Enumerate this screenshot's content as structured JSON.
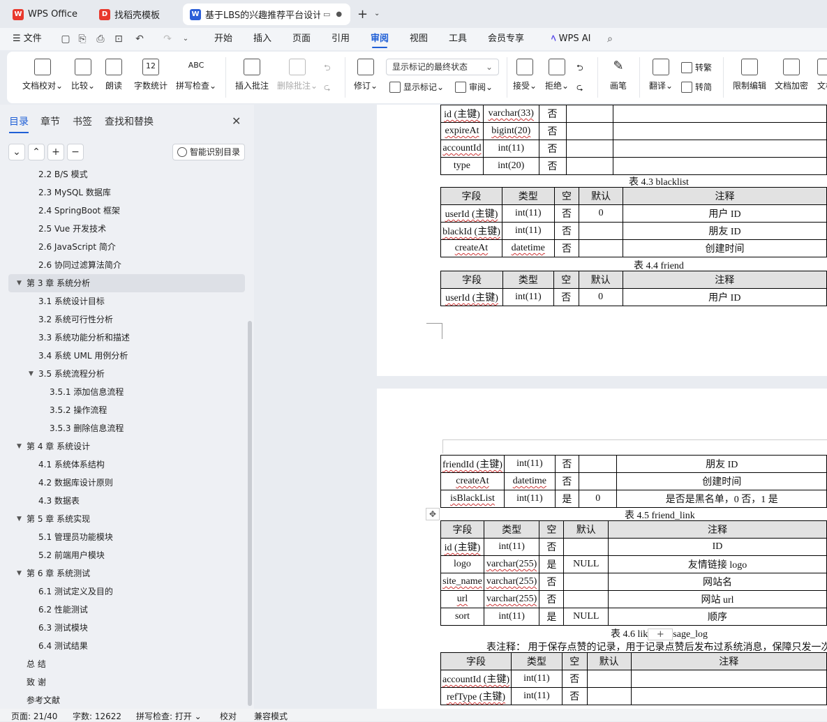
{
  "tabs": [
    {
      "label": "WPS Office",
      "icon": "wps-logo-icon"
    },
    {
      "label": "找稻壳模板",
      "icon": "docer-logo-icon"
    },
    {
      "label": "基于LBS的兴趣推荐平台设计与",
      "icon": "wps-writer-icon"
    }
  ],
  "menu": {
    "file": "文件",
    "items": [
      "开始",
      "插入",
      "页面",
      "引用",
      "审阅",
      "视图",
      "工具",
      "会员专享"
    ],
    "active": "审阅",
    "ai": "WPS AI"
  },
  "ribbon": {
    "doc_check": "文档校对",
    "compare": "比较",
    "read_aloud": "朗读",
    "word_count": "字数统计",
    "spell_check": "拼写检查",
    "spell_icon_text": "ABC",
    "count_icon_text": "12",
    "insert_comment": "插入批注",
    "delete_comment": "删除批注",
    "revise": "修订",
    "markup_state": "显示标记的最终状态",
    "show_markup": "显示标记",
    "review": "审阅",
    "accept": "接受",
    "reject": "拒绝",
    "pen": "画笔",
    "translate": "翻译",
    "to_traditional": "转繁",
    "to_simplified": "转简",
    "restrict_edit": "限制编辑",
    "doc_encrypt": "文档加密",
    "doc_more": "文档"
  },
  "panel": {
    "tabs": [
      "目录",
      "章节",
      "书签",
      "查找和替换"
    ],
    "smart_toc": "智能识别目录",
    "toc": [
      {
        "text": "2.2 B/S 模式",
        "level": 2
      },
      {
        "text": "2.3 MySQL 数据库",
        "level": 2
      },
      {
        "text": "2.4 SpringBoot 框架",
        "level": 2
      },
      {
        "text": "2.5 Vue 开发技术",
        "level": 2
      },
      {
        "text": "2.6 JavaScript 简介",
        "level": 2
      },
      {
        "text": "2.6  协同过滤算法简介",
        "level": 2
      },
      {
        "text": "第 3 章  系统分析",
        "level": 1,
        "expanded": true,
        "selected": true
      },
      {
        "text": "3.1  系统设计目标",
        "level": 2
      },
      {
        "text": "3.2  系统可行性分析",
        "level": 2
      },
      {
        "text": "3.3  系统功能分析和描述",
        "level": 2
      },
      {
        "text": "3.4  系统 UML 用例分析",
        "level": 2
      },
      {
        "text": "3.5 系统流程分析",
        "level": 2,
        "expanded": true
      },
      {
        "text": "3.5.1 添加信息流程",
        "level": 3
      },
      {
        "text": "3.5.2 操作流程",
        "level": 3
      },
      {
        "text": "3.5.3 删除信息流程",
        "level": 3
      },
      {
        "text": "第 4 章  系统设计",
        "level": 1,
        "expanded": true
      },
      {
        "text": "4.1  系统体系结构",
        "level": 2
      },
      {
        "text": "4.2  数据库设计原则",
        "level": 2
      },
      {
        "text": "4.3  数据表",
        "level": 2
      },
      {
        "text": "第 5 章  系统实现",
        "level": 1,
        "expanded": true
      },
      {
        "text": "5.1  管理员功能模块",
        "level": 2
      },
      {
        "text": "5.2  前端用户模块",
        "level": 2
      },
      {
        "text": "第 6 章  系统测试",
        "level": 1,
        "expanded": true
      },
      {
        "text": "6.1 测试定义及目的",
        "level": 2
      },
      {
        "text": "6.2 性能测试",
        "level": 2
      },
      {
        "text": "6.3 测试模块",
        "level": 2
      },
      {
        "text": "6.4 测试结果",
        "level": 2
      },
      {
        "text": "总    结",
        "level": 1
      },
      {
        "text": "致    谢",
        "level": 1
      },
      {
        "text": "参考文献",
        "level": 1
      }
    ]
  },
  "doc": {
    "t42_rows": [
      [
        "id (主键)",
        "varchar(33)",
        "否",
        "",
        ""
      ],
      [
        "expireAt",
        "bigint(20)",
        "否",
        "",
        ""
      ],
      [
        "accountId",
        "int(11)",
        "否",
        "",
        ""
      ],
      [
        "type",
        "int(20)",
        "否",
        "",
        ""
      ]
    ],
    "t43_caption": "表 4.3 blacklist",
    "headers": [
      "字段",
      "类型",
      "空",
      "默认",
      "注释"
    ],
    "t43_rows": [
      [
        "userId (主键)",
        "int(11)",
        "否",
        "0",
        "用户 ID"
      ],
      [
        "blackId (主键)",
        "int(11)",
        "否",
        "",
        "朋友 ID"
      ],
      [
        "createAt",
        "datetime",
        "否",
        "",
        "创建时间"
      ]
    ],
    "t44_caption": "表 4.4 friend",
    "t44_rows": [
      [
        "userId (主键)",
        "int(11)",
        "否",
        "0",
        "用户 ID"
      ]
    ],
    "t44b_rows": [
      [
        "friendId (主键)",
        "int(11)",
        "否",
        "",
        "朋友 ID"
      ],
      [
        "createAt",
        "datetime",
        "否",
        "",
        "创建时间"
      ],
      [
        "isBlackList",
        "int(11)",
        "是",
        "0",
        "是否是黑名单，0 否，1 是"
      ]
    ],
    "t45_caption": "表 4.5 friend_link",
    "t45_rows": [
      [
        "id (主键)",
        "int(11)",
        "否",
        "",
        "ID"
      ],
      [
        "logo",
        "varchar(255)",
        "是",
        "NULL",
        "友情链接 logo"
      ],
      [
        "site_name",
        "varchar(255)",
        "否",
        "",
        "网站名"
      ],
      [
        "url",
        "varchar(255)",
        "否",
        "",
        "网站 url"
      ],
      [
        "sort",
        "int(11)",
        "是",
        "NULL",
        "顺序"
      ]
    ],
    "t46_caption_a": "表 4.6 lik",
    "t46_caption_b": "sage_log",
    "t46_note": "表注释：  用于保存点赞的记录，用于记录点赞后发布过系统消息，保障只发一次",
    "t46_rows": [
      [
        "accountId (主键)",
        "int(11)",
        "否",
        "",
        ""
      ],
      [
        "refType (主键)",
        "int(11)",
        "否",
        "",
        ""
      ]
    ]
  },
  "status": {
    "page": "页面: 21/40",
    "words": "字数: 12622",
    "spell": "拼写检查: 打开",
    "proof": "校对",
    "compat": "兼容模式"
  }
}
